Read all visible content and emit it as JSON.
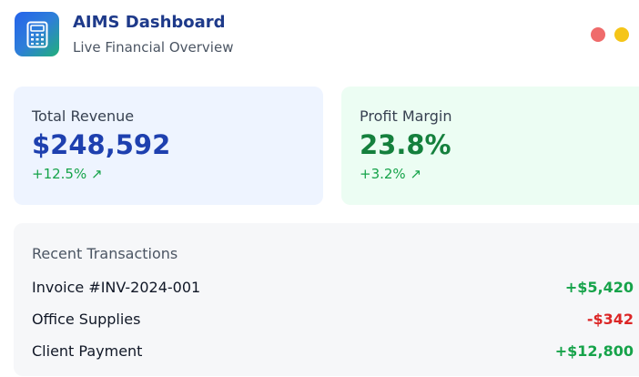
{
  "header": {
    "title": "AIMS Dashboard",
    "subtitle": "Live Financial Overview",
    "icon": "calculator-icon"
  },
  "window_controls": {
    "colors": [
      "#ef6b6b",
      "#f5c518"
    ]
  },
  "metrics": {
    "revenue": {
      "label": "Total Revenue",
      "value": "$248,592",
      "change": "+12.5% ↗",
      "value_color": "#1e40af"
    },
    "profit": {
      "label": "Profit Margin",
      "value": "23.8%",
      "change": "+3.2% ↗",
      "value_color": "#15803d"
    }
  },
  "transactions": {
    "title": "Recent Transactions",
    "items": [
      {
        "name": "Invoice #INV-2024-001",
        "amount": "+$5,420",
        "color": "#16a34a"
      },
      {
        "name": "Office Supplies",
        "amount": "-$342",
        "color": "#dc2626"
      },
      {
        "name": "Client Payment",
        "amount": "+$12,800",
        "color": "#16a34a"
      }
    ]
  }
}
